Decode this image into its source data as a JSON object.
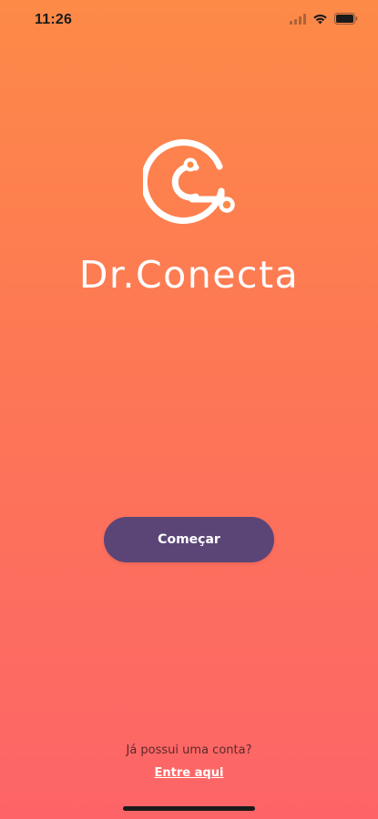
{
  "status_bar": {
    "time": "11:26",
    "icons": [
      "signal-icon",
      "wifi-icon",
      "battery-icon"
    ]
  },
  "brand": {
    "name": "Dr.Conecta",
    "logo_icon": "dr-conecta-logo-icon"
  },
  "actions": {
    "start_label": "Começar"
  },
  "footer": {
    "account_question": "Já possui uma conta?",
    "login_link": "Entre aqui"
  },
  "colors": {
    "gradient_top": "#fd8a47",
    "gradient_bottom": "#fd6468",
    "button": "#5b4577",
    "text_light": "#ffffff"
  }
}
